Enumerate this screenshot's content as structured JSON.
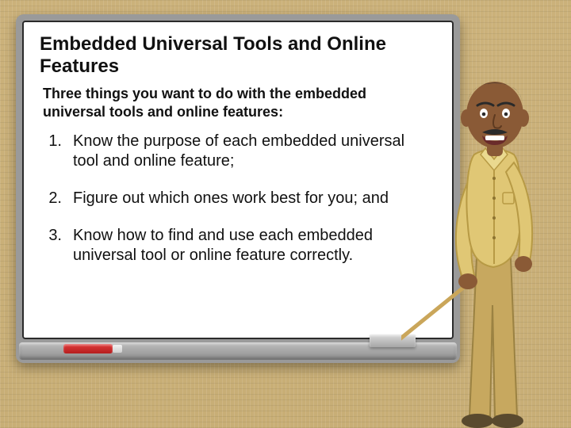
{
  "title": "Embedded Universal Tools and Online Features",
  "subtitle": "Three things you want to do with the embedded universal tools and online features:",
  "items": [
    {
      "num": "1.",
      "text": "Know the purpose of each embedded universal tool and online feature;"
    },
    {
      "num": "2.",
      "text": "Figure out which ones work best for you; and"
    },
    {
      "num": "3.",
      "text": "Know how to find and use each embedded universal tool or online feature correctly."
    }
  ],
  "colors": {
    "background": "#cdb47e",
    "skin": "#8a5a36",
    "shirt": "#e0c775",
    "pants": "#c7a85f",
    "shoe": "#5a4a2e"
  }
}
